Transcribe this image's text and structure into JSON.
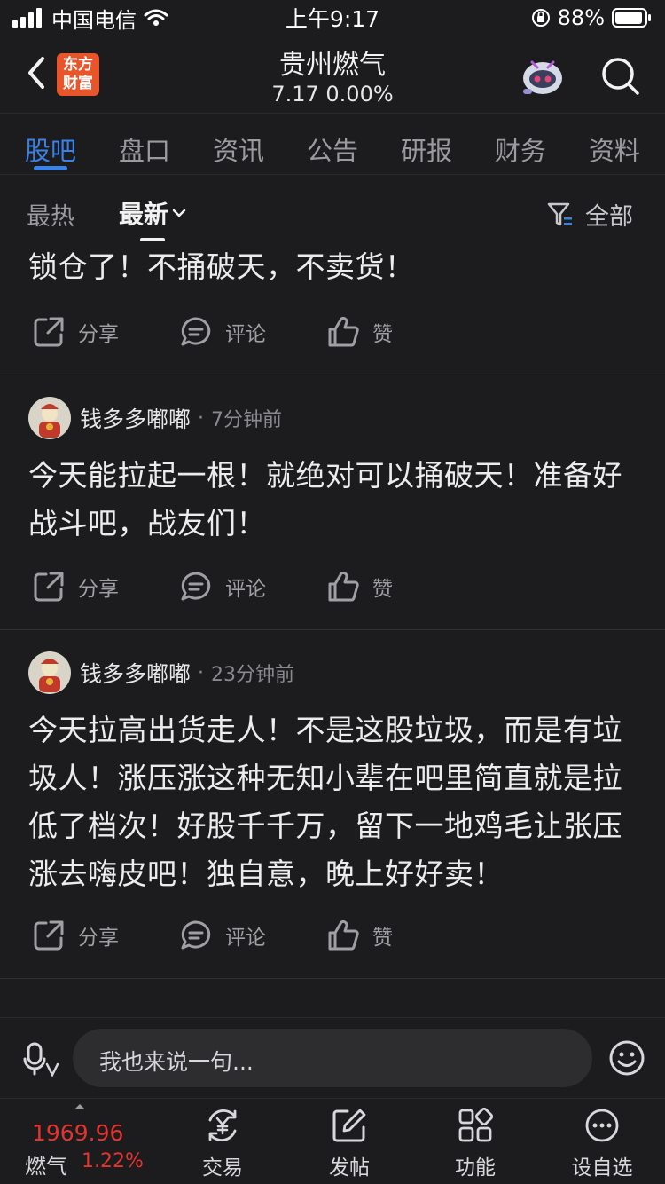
{
  "status_bar": {
    "carrier": "中国电信",
    "time": "上午9:17",
    "battery": "88%"
  },
  "header": {
    "logo_text_line1": "东方",
    "logo_text_line2": "财富",
    "title": "贵州燃气",
    "subtitle": "7.17  0.00%"
  },
  "tabs": [
    {
      "label": "股吧",
      "active": true
    },
    {
      "label": "盘口"
    },
    {
      "label": "资讯"
    },
    {
      "label": "公告"
    },
    {
      "label": "研报"
    },
    {
      "label": "财务"
    },
    {
      "label": "资料"
    }
  ],
  "sort": {
    "hot": "最热",
    "newest": "最新",
    "filter_label": "全部"
  },
  "actions": {
    "share": "分享",
    "comment": "评论",
    "like": "赞"
  },
  "posts": [
    {
      "text": "锁仓了！不捅破天，不卖货！"
    },
    {
      "author": "钱多多嘟嘟",
      "time": "7分钟前",
      "text": "今天能拉起一根！就绝对可以捅破天！准备好战斗吧，战友们！"
    },
    {
      "author": "钱多多嘟嘟",
      "time": "23分钟前",
      "text": "今天拉高出货走人！不是这股垃圾，而是有垃圾人！涨压涨这种无知小辈在吧里简直就是拉低了档次！好股千千万，留下一地鸡毛让张压涨去嗨皮吧！独自意，晚上好好卖！"
    }
  ],
  "comment_bar": {
    "placeholder": "我也来说一句..."
  },
  "bottom_nav": {
    "quote_price": "1969.96",
    "quote_name": "燃气",
    "quote_pct": "1.22%",
    "items": [
      {
        "label": "交易",
        "icon": "yen-cycle-icon"
      },
      {
        "label": "发帖",
        "icon": "edit-icon"
      },
      {
        "label": "功能",
        "icon": "grid-icon"
      },
      {
        "label": "设自选",
        "icon": "more-icon"
      }
    ]
  },
  "colors": {
    "accent_blue": "#3b82e8",
    "rise_red": "#e5332e",
    "logo_orange": "#e8552a",
    "background": "#1c1c1e"
  }
}
